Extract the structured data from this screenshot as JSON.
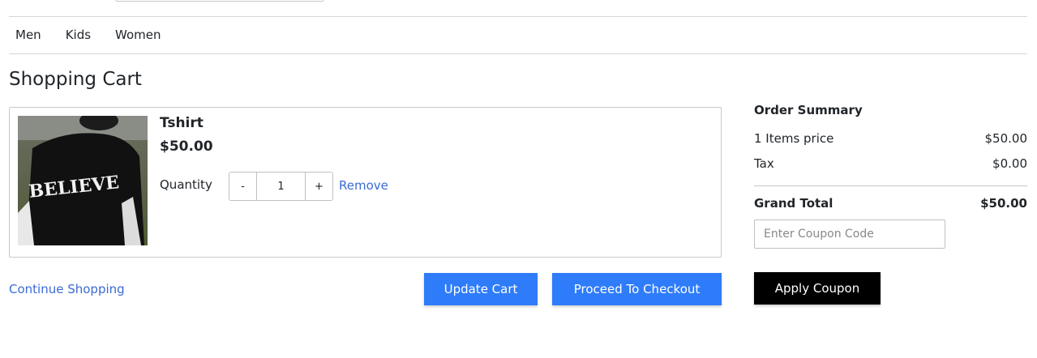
{
  "nav": {
    "items": [
      {
        "label": "Men"
      },
      {
        "label": "Kids"
      },
      {
        "label": "Women"
      }
    ]
  },
  "page_title": "Shopping Cart",
  "cart": {
    "item": {
      "name": "Tshirt",
      "price": "$50.00",
      "image_text": "BELIEVE",
      "quantity_label": "Quantity",
      "quantity": "1",
      "decrement_label": "-",
      "increment_label": "+",
      "remove_label": "Remove"
    }
  },
  "actions": {
    "continue_label": "Continue Shopping",
    "update_label": "Update Cart",
    "checkout_label": "Proceed To Checkout"
  },
  "summary": {
    "title": "Order Summary",
    "items_price_label": "1 Items price",
    "items_price_value": "$50.00",
    "tax_label": "Tax",
    "tax_value": "$0.00",
    "grand_total_label": "Grand Total",
    "grand_total_value": "$50.00",
    "coupon_placeholder": "Enter Coupon Code",
    "apply_label": "Apply Coupon"
  },
  "colors": {
    "link": "#3b6bd6",
    "primary_button": "#2f7cfa",
    "apply_button": "#000000"
  }
}
